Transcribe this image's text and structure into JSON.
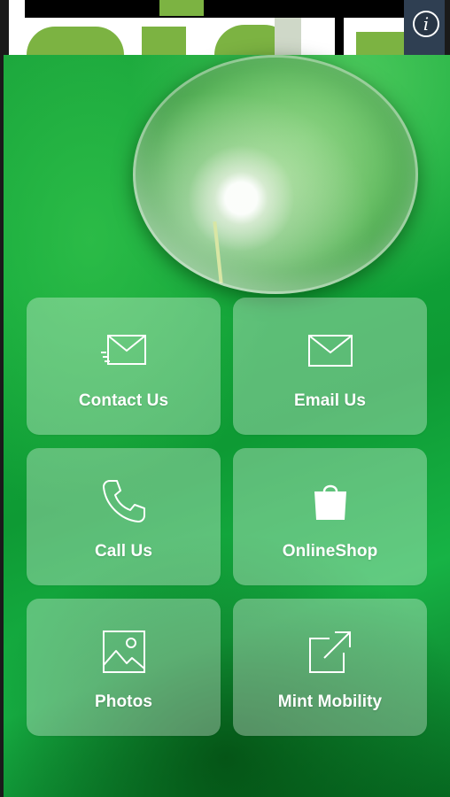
{
  "header": {
    "info_icon": "info-icon",
    "info_glyph": "i"
  },
  "colors": {
    "accent": "#7cb342",
    "background_green": "#12a83a",
    "tile_overlay": "rgba(255,255,255,0.32)",
    "text": "#ffffff"
  },
  "tiles": [
    {
      "label": "Contact Us",
      "icon": "contact-envelope-icon"
    },
    {
      "label": "Email Us",
      "icon": "envelope-icon"
    },
    {
      "label": "Call Us",
      "icon": "phone-icon"
    },
    {
      "label": "OnlineShop",
      "icon": "shopping-bag-icon"
    },
    {
      "label": "Photos",
      "icon": "photo-icon"
    },
    {
      "label": "Mint Mobility",
      "icon": "external-link-icon"
    }
  ]
}
